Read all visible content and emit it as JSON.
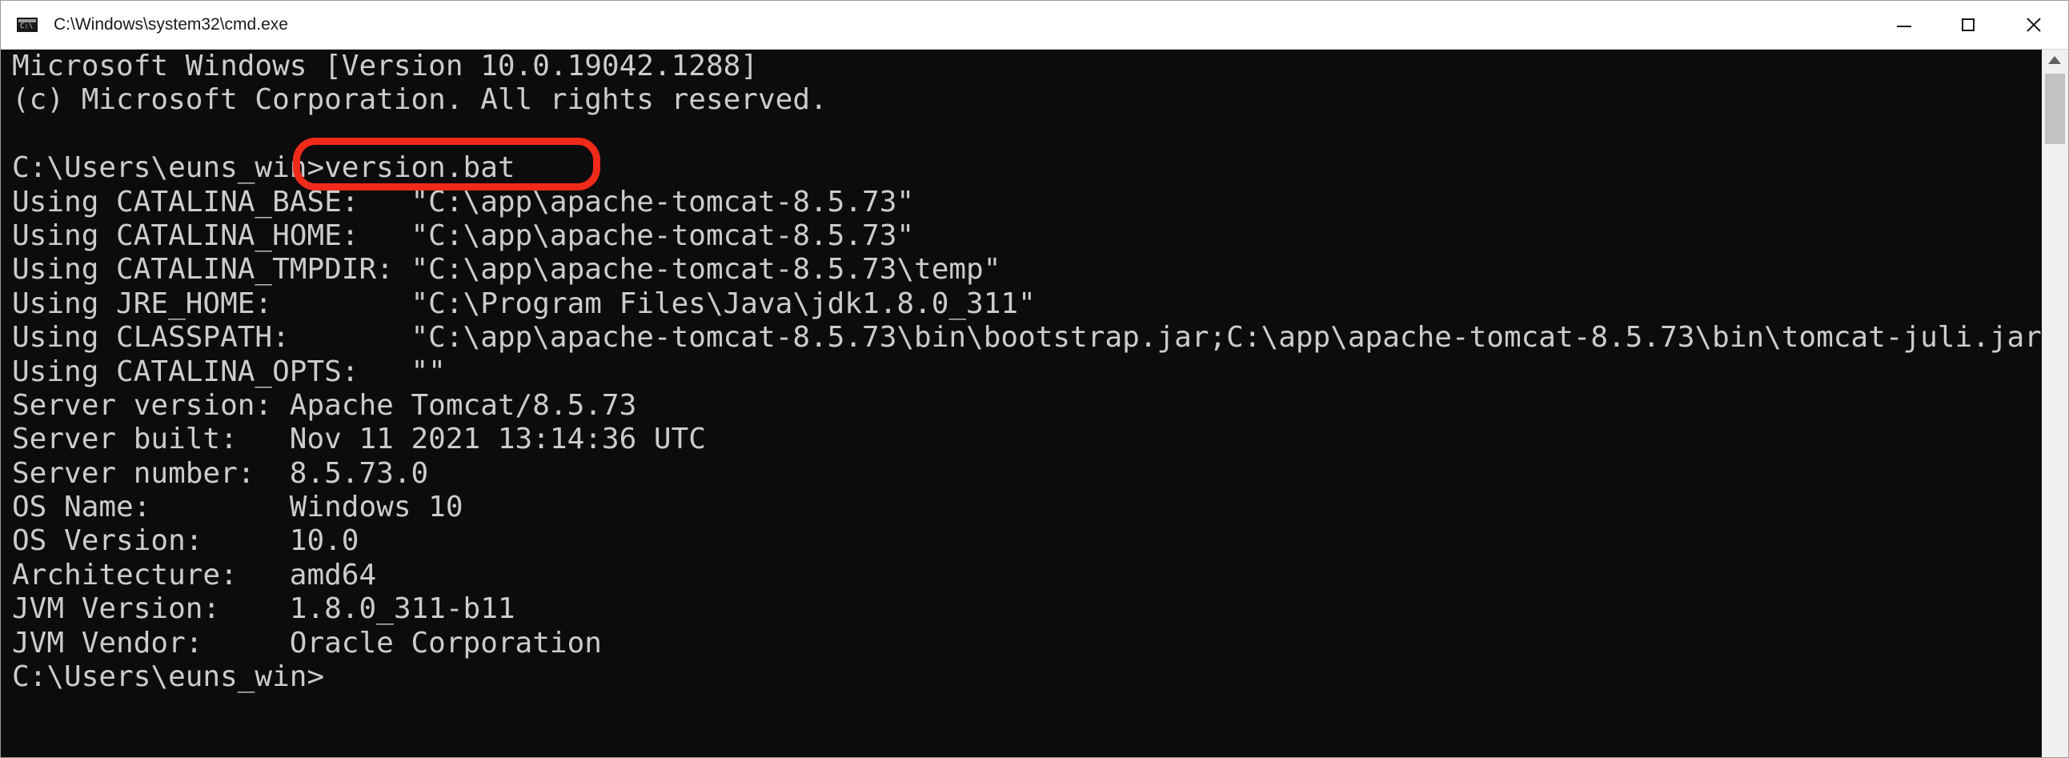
{
  "window": {
    "title": "C:\\Windows\\system32\\cmd.exe",
    "icon_glyph": "C:\\",
    "controls": {
      "minimize": "minimize-icon",
      "maximize": "maximize-icon",
      "close": "close-icon",
      "close_glyph": "✕"
    }
  },
  "console": {
    "lines": [
      "Microsoft Windows [Version 10.0.19042.1288]",
      "(c) Microsoft Corporation. All rights reserved.",
      "",
      "C:\\Users\\euns_win>version.bat",
      "Using CATALINA_BASE:   \"C:\\app\\apache-tomcat-8.5.73\"",
      "Using CATALINA_HOME:   \"C:\\app\\apache-tomcat-8.5.73\"",
      "Using CATALINA_TMPDIR: \"C:\\app\\apache-tomcat-8.5.73\\temp\"",
      "Using JRE_HOME:        \"C:\\Program Files\\Java\\jdk1.8.0_311\"",
      "Using CLASSPATH:       \"C:\\app\\apache-tomcat-8.5.73\\bin\\bootstrap.jar;C:\\app\\apache-tomcat-8.5.73\\bin\\tomcat-juli.jar\"",
      "Using CATALINA_OPTS:   \"\"",
      "Server version: Apache Tomcat/8.5.73",
      "Server built:   Nov 11 2021 13:14:36 UTC",
      "Server number:  8.5.73.0",
      "OS Name:        Windows 10",
      "OS Version:     10.0",
      "Architecture:   amd64",
      "JVM Version:    1.8.0_311-b11",
      "JVM Vendor:     Oracle Corporation",
      "C:\\Users\\euns_win>"
    ]
  },
  "colors": {
    "console_bg": "#0c0c0c",
    "console_fg": "#cccccc",
    "highlight": "#f02a1a"
  }
}
